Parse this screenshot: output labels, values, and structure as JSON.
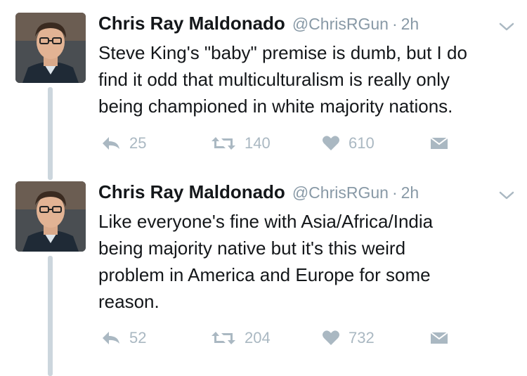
{
  "tweets": [
    {
      "name": "Chris Ray Maldonado",
      "handle": "@ChrisRGun",
      "separator": "·",
      "time": "2h",
      "lines": [
        "Steve King's \"baby\" premise is dumb, but I do",
        "find it odd that multiculturalism is really only",
        "being championed in white majority nations."
      ],
      "replies": "25",
      "retweets": "140",
      "likes": "610"
    },
    {
      "name": "Chris Ray Maldonado",
      "handle": "@ChrisRGun",
      "separator": "·",
      "time": "2h",
      "lines": [
        "Like everyone's fine with Asia/Africa/India",
        "being majority native but it's this weird",
        "problem in America and Europe for some",
        "reason."
      ],
      "replies": "52",
      "retweets": "204",
      "likes": "732"
    }
  ],
  "icons": {
    "reply": "reply-icon",
    "retweet": "retweet-icon",
    "like": "heart-icon",
    "dm": "envelope-icon",
    "menu": "chevron-down-icon"
  },
  "colors": {
    "text": "#14171a",
    "muted": "#8899a6",
    "action": "#aab8c2",
    "thread_line": "#ccd6dd"
  }
}
